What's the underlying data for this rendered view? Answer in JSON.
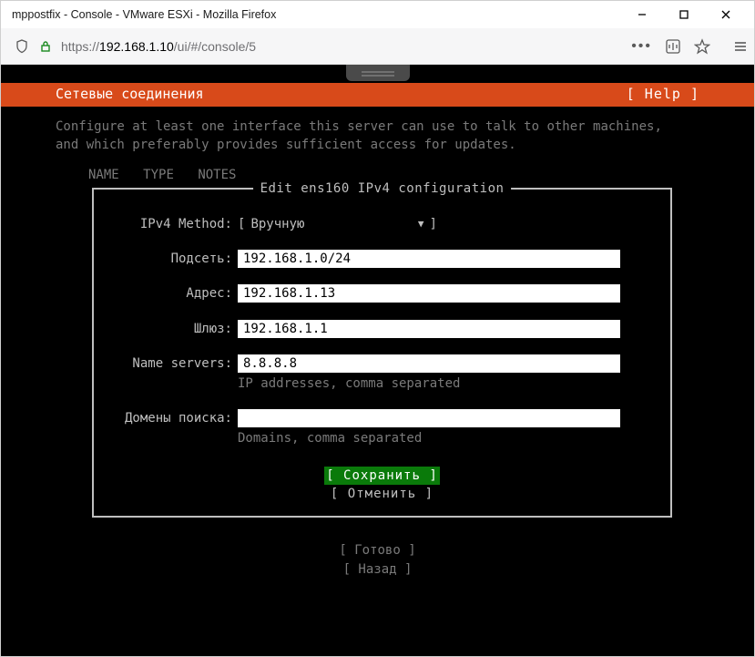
{
  "window": {
    "title": "mppostfix - Console - VMware ESXi - Mozilla Firefox"
  },
  "url": {
    "prefix": "https://",
    "host": "192.168.1.10",
    "path": "/ui/#/console/5"
  },
  "header": {
    "title": "Сетевые соединения",
    "help": "[ Help ]"
  },
  "description": "Configure at least one interface this server can use to talk to other machines,\nand which preferably provides sufficient access for updates.",
  "columns": {
    "name": "NAME",
    "type": "TYPE",
    "notes": "NOTES"
  },
  "dialog": {
    "title": "Edit ens160 IPv4 configuration",
    "method_label": "IPv4 Method:",
    "method_value": "Вручную",
    "subnet_label": "Подсеть:",
    "subnet_value": "192.168.1.0/24",
    "address_label": "Адрес:",
    "address_value": "192.168.1.13",
    "gateway_label": "Шлюз:",
    "gateway_value": "192.168.1.1",
    "nameservers_label": "Name servers:",
    "nameservers_value": "8.8.8.8",
    "nameservers_hint": "IP addresses, comma separated",
    "searchdomains_label": "Домены поиска:",
    "searchdomains_value": "",
    "searchdomains_hint": "Domains, comma separated",
    "save": "[ Сохранить  ]",
    "cancel": "[ Отменить   ]"
  },
  "footer": {
    "done": "[ Готово    ]",
    "back": "[ Назад     ]"
  }
}
